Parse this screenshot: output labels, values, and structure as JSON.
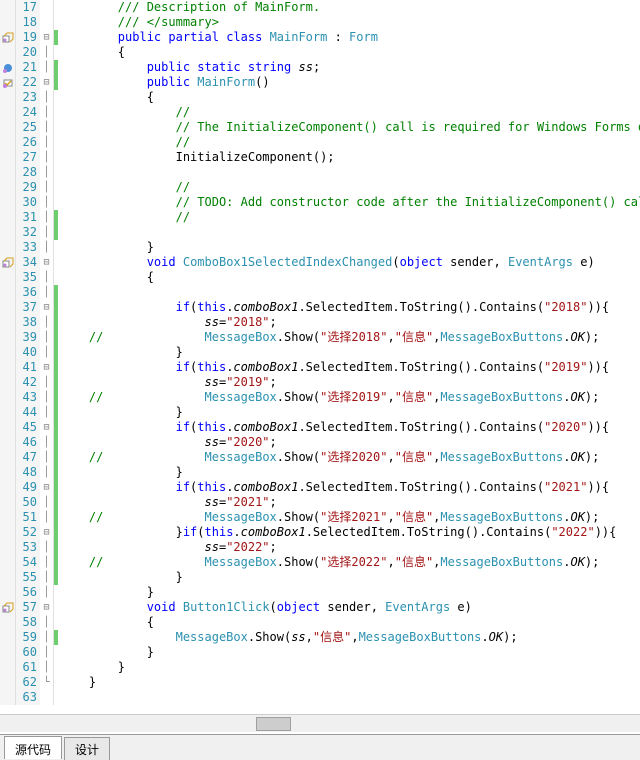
{
  "tabs": {
    "source": "源代码",
    "design": "设计"
  },
  "lines": [
    {
      "n": 17,
      "m": "",
      "f": "",
      "ch": "",
      "tok": [
        [
          "n",
          "        "
        ],
        [
          "c",
          "/// Description of MainForm."
        ]
      ]
    },
    {
      "n": 18,
      "m": "",
      "f": "",
      "ch": "",
      "tok": [
        [
          "n",
          "        "
        ],
        [
          "c",
          "/// </summary>"
        ]
      ]
    },
    {
      "n": 19,
      "m": "m1",
      "f": "⊟",
      "ch": "g",
      "tok": [
        [
          "n",
          "        "
        ],
        [
          "k",
          "public"
        ],
        [
          "n",
          " "
        ],
        [
          "k",
          "partial"
        ],
        [
          "n",
          " "
        ],
        [
          "k",
          "class"
        ],
        [
          "n",
          " "
        ],
        [
          "t",
          "MainForm"
        ],
        [
          "n",
          " : "
        ],
        [
          "t",
          "Form"
        ]
      ]
    },
    {
      "n": 20,
      "m": "",
      "f": "│",
      "ch": "",
      "tok": [
        [
          "n",
          "        {"
        ]
      ]
    },
    {
      "n": 21,
      "m": "m2",
      "f": "│",
      "ch": "g",
      "tok": [
        [
          "n",
          "            "
        ],
        [
          "k",
          "public"
        ],
        [
          "n",
          " "
        ],
        [
          "k",
          "static"
        ],
        [
          "n",
          " "
        ],
        [
          "k",
          "string"
        ],
        [
          "n",
          " "
        ],
        [
          "id",
          "ss"
        ],
        [
          "n",
          ";"
        ]
      ]
    },
    {
      "n": 22,
      "m": "m3",
      "f": "⊟",
      "ch": "g",
      "tok": [
        [
          "n",
          "            "
        ],
        [
          "k",
          "public"
        ],
        [
          "n",
          " "
        ],
        [
          "t",
          "MainForm"
        ],
        [
          "n",
          "()"
        ]
      ]
    },
    {
      "n": 23,
      "m": "",
      "f": "│",
      "ch": "",
      "tok": [
        [
          "n",
          "            {"
        ]
      ]
    },
    {
      "n": 24,
      "m": "",
      "f": "│",
      "ch": "",
      "tok": [
        [
          "n",
          "                "
        ],
        [
          "c",
          "//"
        ]
      ]
    },
    {
      "n": 25,
      "m": "",
      "f": "│",
      "ch": "",
      "tok": [
        [
          "n",
          "                "
        ],
        [
          "c",
          "// The InitializeComponent() call is required for Windows Forms desig"
        ]
      ]
    },
    {
      "n": 26,
      "m": "",
      "f": "│",
      "ch": "",
      "tok": [
        [
          "n",
          "                "
        ],
        [
          "c",
          "//"
        ]
      ]
    },
    {
      "n": 27,
      "m": "",
      "f": "│",
      "ch": "",
      "tok": [
        [
          "n",
          "                "
        ],
        [
          "n",
          "InitializeComponent();"
        ]
      ]
    },
    {
      "n": 28,
      "m": "",
      "f": "│",
      "ch": "",
      "tok": [
        [
          "n",
          ""
        ]
      ]
    },
    {
      "n": 29,
      "m": "",
      "f": "│",
      "ch": "",
      "tok": [
        [
          "n",
          "                "
        ],
        [
          "c",
          "//"
        ]
      ]
    },
    {
      "n": 30,
      "m": "",
      "f": "│",
      "ch": "",
      "tok": [
        [
          "n",
          "                "
        ],
        [
          "c",
          "// TODO: Add constructor code after the InitializeComponent() call."
        ]
      ]
    },
    {
      "n": 31,
      "m": "",
      "f": "│",
      "ch": "g",
      "tok": [
        [
          "n",
          "                "
        ],
        [
          "c",
          "//"
        ]
      ]
    },
    {
      "n": 32,
      "m": "",
      "f": "│",
      "ch": "g",
      "tok": [
        [
          "n",
          ""
        ]
      ]
    },
    {
      "n": 33,
      "m": "",
      "f": "│",
      "ch": "",
      "tok": [
        [
          "n",
          "            }"
        ]
      ]
    },
    {
      "n": 34,
      "m": "m1",
      "f": "⊟",
      "ch": "",
      "tok": [
        [
          "n",
          "            "
        ],
        [
          "k",
          "void"
        ],
        [
          "n",
          " "
        ],
        [
          "t",
          "ComboBox1SelectedIndexChanged"
        ],
        [
          "n",
          "("
        ],
        [
          "k",
          "object"
        ],
        [
          "n",
          " sender, "
        ],
        [
          "t",
          "EventArgs"
        ],
        [
          "n",
          " e)"
        ]
      ]
    },
    {
      "n": 35,
      "m": "",
      "f": "│",
      "ch": "",
      "tok": [
        [
          "n",
          "            {"
        ]
      ]
    },
    {
      "n": 36,
      "m": "",
      "f": "│",
      "ch": "g",
      "tok": [
        [
          "n",
          ""
        ]
      ]
    },
    {
      "n": 37,
      "m": "",
      "f": "⊟",
      "ch": "g",
      "tok": [
        [
          "n",
          "                "
        ],
        [
          "k",
          "if"
        ],
        [
          "n",
          "("
        ],
        [
          "k",
          "this"
        ],
        [
          "n",
          "."
        ],
        [
          "id",
          "comboBox1"
        ],
        [
          "n",
          ".SelectedItem.ToString().Contains("
        ],
        [
          "s",
          "\"2018\""
        ],
        [
          "n",
          ")){"
        ]
      ]
    },
    {
      "n": 38,
      "m": "",
      "f": "│",
      "ch": "g",
      "tok": [
        [
          "n",
          "                    "
        ],
        [
          "id",
          "ss"
        ],
        [
          "n",
          "="
        ],
        [
          "s",
          "\"2018\""
        ],
        [
          "n",
          ";"
        ]
      ]
    },
    {
      "n": 39,
      "m": "",
      "f": "│",
      "ch": "g",
      "tok": [
        [
          "n",
          "    "
        ],
        [
          "c",
          "//"
        ],
        [
          "n",
          "              "
        ],
        [
          "t",
          "MessageBox"
        ],
        [
          "n",
          ".Show("
        ],
        [
          "s",
          "\"选择2018\""
        ],
        [
          "n",
          ","
        ],
        [
          "s",
          "\"信息\""
        ],
        [
          "n",
          ","
        ],
        [
          "t",
          "MessageBoxButtons"
        ],
        [
          "n",
          "."
        ],
        [
          "id",
          "OK"
        ],
        [
          "n",
          ");"
        ]
      ]
    },
    {
      "n": 40,
      "m": "",
      "f": "│",
      "ch": "g",
      "tok": [
        [
          "n",
          "                }"
        ]
      ]
    },
    {
      "n": 41,
      "m": "",
      "f": "⊟",
      "ch": "g",
      "tok": [
        [
          "n",
          "                "
        ],
        [
          "k",
          "if"
        ],
        [
          "n",
          "("
        ],
        [
          "k",
          "this"
        ],
        [
          "n",
          "."
        ],
        [
          "id",
          "comboBox1"
        ],
        [
          "n",
          ".SelectedItem.ToString().Contains("
        ],
        [
          "s",
          "\"2019\""
        ],
        [
          "n",
          ")){"
        ]
      ]
    },
    {
      "n": 42,
      "m": "",
      "f": "│",
      "ch": "g",
      "tok": [
        [
          "n",
          "                    "
        ],
        [
          "id",
          "ss"
        ],
        [
          "n",
          "="
        ],
        [
          "s",
          "\"2019\""
        ],
        [
          "n",
          ";"
        ]
      ]
    },
    {
      "n": 43,
      "m": "",
      "f": "│",
      "ch": "g",
      "tok": [
        [
          "n",
          "    "
        ],
        [
          "c",
          "//"
        ],
        [
          "n",
          "              "
        ],
        [
          "t",
          "MessageBox"
        ],
        [
          "n",
          ".Show("
        ],
        [
          "s",
          "\"选择2019\""
        ],
        [
          "n",
          ","
        ],
        [
          "s",
          "\"信息\""
        ],
        [
          "n",
          ","
        ],
        [
          "t",
          "MessageBoxButtons"
        ],
        [
          "n",
          "."
        ],
        [
          "id",
          "OK"
        ],
        [
          "n",
          ");"
        ]
      ]
    },
    {
      "n": 44,
      "m": "",
      "f": "│",
      "ch": "g",
      "tok": [
        [
          "n",
          "                }"
        ]
      ]
    },
    {
      "n": 45,
      "m": "",
      "f": "⊟",
      "ch": "g",
      "tok": [
        [
          "n",
          "                "
        ],
        [
          "k",
          "if"
        ],
        [
          "n",
          "("
        ],
        [
          "k",
          "this"
        ],
        [
          "n",
          "."
        ],
        [
          "id",
          "comboBox1"
        ],
        [
          "n",
          ".SelectedItem.ToString().Contains("
        ],
        [
          "s",
          "\"2020\""
        ],
        [
          "n",
          ")){"
        ]
      ]
    },
    {
      "n": 46,
      "m": "",
      "f": "│",
      "ch": "g",
      "tok": [
        [
          "n",
          "                    "
        ],
        [
          "id",
          "ss"
        ],
        [
          "n",
          "="
        ],
        [
          "s",
          "\"2020\""
        ],
        [
          "n",
          ";"
        ]
      ]
    },
    {
      "n": 47,
      "m": "",
      "f": "│",
      "ch": "g",
      "tok": [
        [
          "n",
          "    "
        ],
        [
          "c",
          "//"
        ],
        [
          "n",
          "              "
        ],
        [
          "t",
          "MessageBox"
        ],
        [
          "n",
          ".Show("
        ],
        [
          "s",
          "\"选择2020\""
        ],
        [
          "n",
          ","
        ],
        [
          "s",
          "\"信息\""
        ],
        [
          "n",
          ","
        ],
        [
          "t",
          "MessageBoxButtons"
        ],
        [
          "n",
          "."
        ],
        [
          "id",
          "OK"
        ],
        [
          "n",
          ");"
        ]
      ]
    },
    {
      "n": 48,
      "m": "",
      "f": "│",
      "ch": "g",
      "tok": [
        [
          "n",
          "                }"
        ]
      ]
    },
    {
      "n": 49,
      "m": "",
      "f": "⊟",
      "ch": "g",
      "tok": [
        [
          "n",
          "                "
        ],
        [
          "k",
          "if"
        ],
        [
          "n",
          "("
        ],
        [
          "k",
          "this"
        ],
        [
          "n",
          "."
        ],
        [
          "id",
          "comboBox1"
        ],
        [
          "n",
          ".SelectedItem.ToString().Contains("
        ],
        [
          "s",
          "\"2021\""
        ],
        [
          "n",
          ")){"
        ]
      ]
    },
    {
      "n": 50,
      "m": "",
      "f": "│",
      "ch": "g",
      "tok": [
        [
          "n",
          "                    "
        ],
        [
          "id",
          "ss"
        ],
        [
          "n",
          "="
        ],
        [
          "s",
          "\"2021\""
        ],
        [
          "n",
          ";"
        ]
      ]
    },
    {
      "n": 51,
      "m": "",
      "f": "│",
      "ch": "g",
      "tok": [
        [
          "n",
          "    "
        ],
        [
          "c",
          "//"
        ],
        [
          "n",
          "              "
        ],
        [
          "t",
          "MessageBox"
        ],
        [
          "n",
          ".Show("
        ],
        [
          "s",
          "\"选择2021\""
        ],
        [
          "n",
          ","
        ],
        [
          "s",
          "\"信息\""
        ],
        [
          "n",
          ","
        ],
        [
          "t",
          "MessageBoxButtons"
        ],
        [
          "n",
          "."
        ],
        [
          "id",
          "OK"
        ],
        [
          "n",
          ");"
        ]
      ]
    },
    {
      "n": 52,
      "m": "",
      "f": "⊟",
      "ch": "g",
      "tok": [
        [
          "n",
          "                }"
        ],
        [
          "k",
          "if"
        ],
        [
          "n",
          "("
        ],
        [
          "k",
          "this"
        ],
        [
          "n",
          "."
        ],
        [
          "id",
          "comboBox1"
        ],
        [
          "n",
          ".SelectedItem.ToString().Contains("
        ],
        [
          "s",
          "\"2022\""
        ],
        [
          "n",
          ")){"
        ]
      ]
    },
    {
      "n": 53,
      "m": "",
      "f": "│",
      "ch": "g",
      "tok": [
        [
          "n",
          "                    "
        ],
        [
          "id",
          "ss"
        ],
        [
          "n",
          "="
        ],
        [
          "s",
          "\"2022\""
        ],
        [
          "n",
          ";"
        ]
      ]
    },
    {
      "n": 54,
      "m": "",
      "f": "│",
      "ch": "g",
      "tok": [
        [
          "n",
          "    "
        ],
        [
          "c",
          "//"
        ],
        [
          "n",
          "              "
        ],
        [
          "t",
          "MessageBox"
        ],
        [
          "n",
          ".Show("
        ],
        [
          "s",
          "\"选择2022\""
        ],
        [
          "n",
          ","
        ],
        [
          "s",
          "\"信息\""
        ],
        [
          "n",
          ","
        ],
        [
          "t",
          "MessageBoxButtons"
        ],
        [
          "n",
          "."
        ],
        [
          "id",
          "OK"
        ],
        [
          "n",
          ");"
        ]
      ]
    },
    {
      "n": 55,
      "m": "",
      "f": "│",
      "ch": "g",
      "tok": [
        [
          "n",
          "                }"
        ]
      ]
    },
    {
      "n": 56,
      "m": "",
      "f": "│",
      "ch": "",
      "tok": [
        [
          "n",
          "            }"
        ]
      ]
    },
    {
      "n": 57,
      "m": "m1",
      "f": "⊟",
      "ch": "",
      "tok": [
        [
          "n",
          "            "
        ],
        [
          "k",
          "void"
        ],
        [
          "n",
          " "
        ],
        [
          "t",
          "Button1Click"
        ],
        [
          "n",
          "("
        ],
        [
          "k",
          "object"
        ],
        [
          "n",
          " sender, "
        ],
        [
          "t",
          "EventArgs"
        ],
        [
          "n",
          " e)"
        ]
      ]
    },
    {
      "n": 58,
      "m": "",
      "f": "│",
      "ch": "",
      "tok": [
        [
          "n",
          "            {"
        ]
      ]
    },
    {
      "n": 59,
      "m": "",
      "f": "│",
      "ch": "g",
      "tok": [
        [
          "n",
          "                "
        ],
        [
          "t",
          "MessageBox"
        ],
        [
          "n",
          ".Show("
        ],
        [
          "id",
          "ss"
        ],
        [
          "n",
          ","
        ],
        [
          "s",
          "\"信息\""
        ],
        [
          "n",
          ","
        ],
        [
          "t",
          "MessageBoxButtons"
        ],
        [
          "n",
          "."
        ],
        [
          "id",
          "OK"
        ],
        [
          "n",
          ");"
        ]
      ]
    },
    {
      "n": 60,
      "m": "",
      "f": "│",
      "ch": "",
      "tok": [
        [
          "n",
          "            }"
        ]
      ]
    },
    {
      "n": 61,
      "m": "",
      "f": "│",
      "ch": "",
      "tok": [
        [
          "n",
          "        }"
        ]
      ]
    },
    {
      "n": 62,
      "m": "",
      "f": "└",
      "ch": "",
      "tok": [
        [
          "n",
          "    }"
        ]
      ]
    },
    {
      "n": 63,
      "m": "",
      "f": "",
      "ch": "",
      "tok": [
        [
          "n",
          ""
        ]
      ]
    }
  ]
}
